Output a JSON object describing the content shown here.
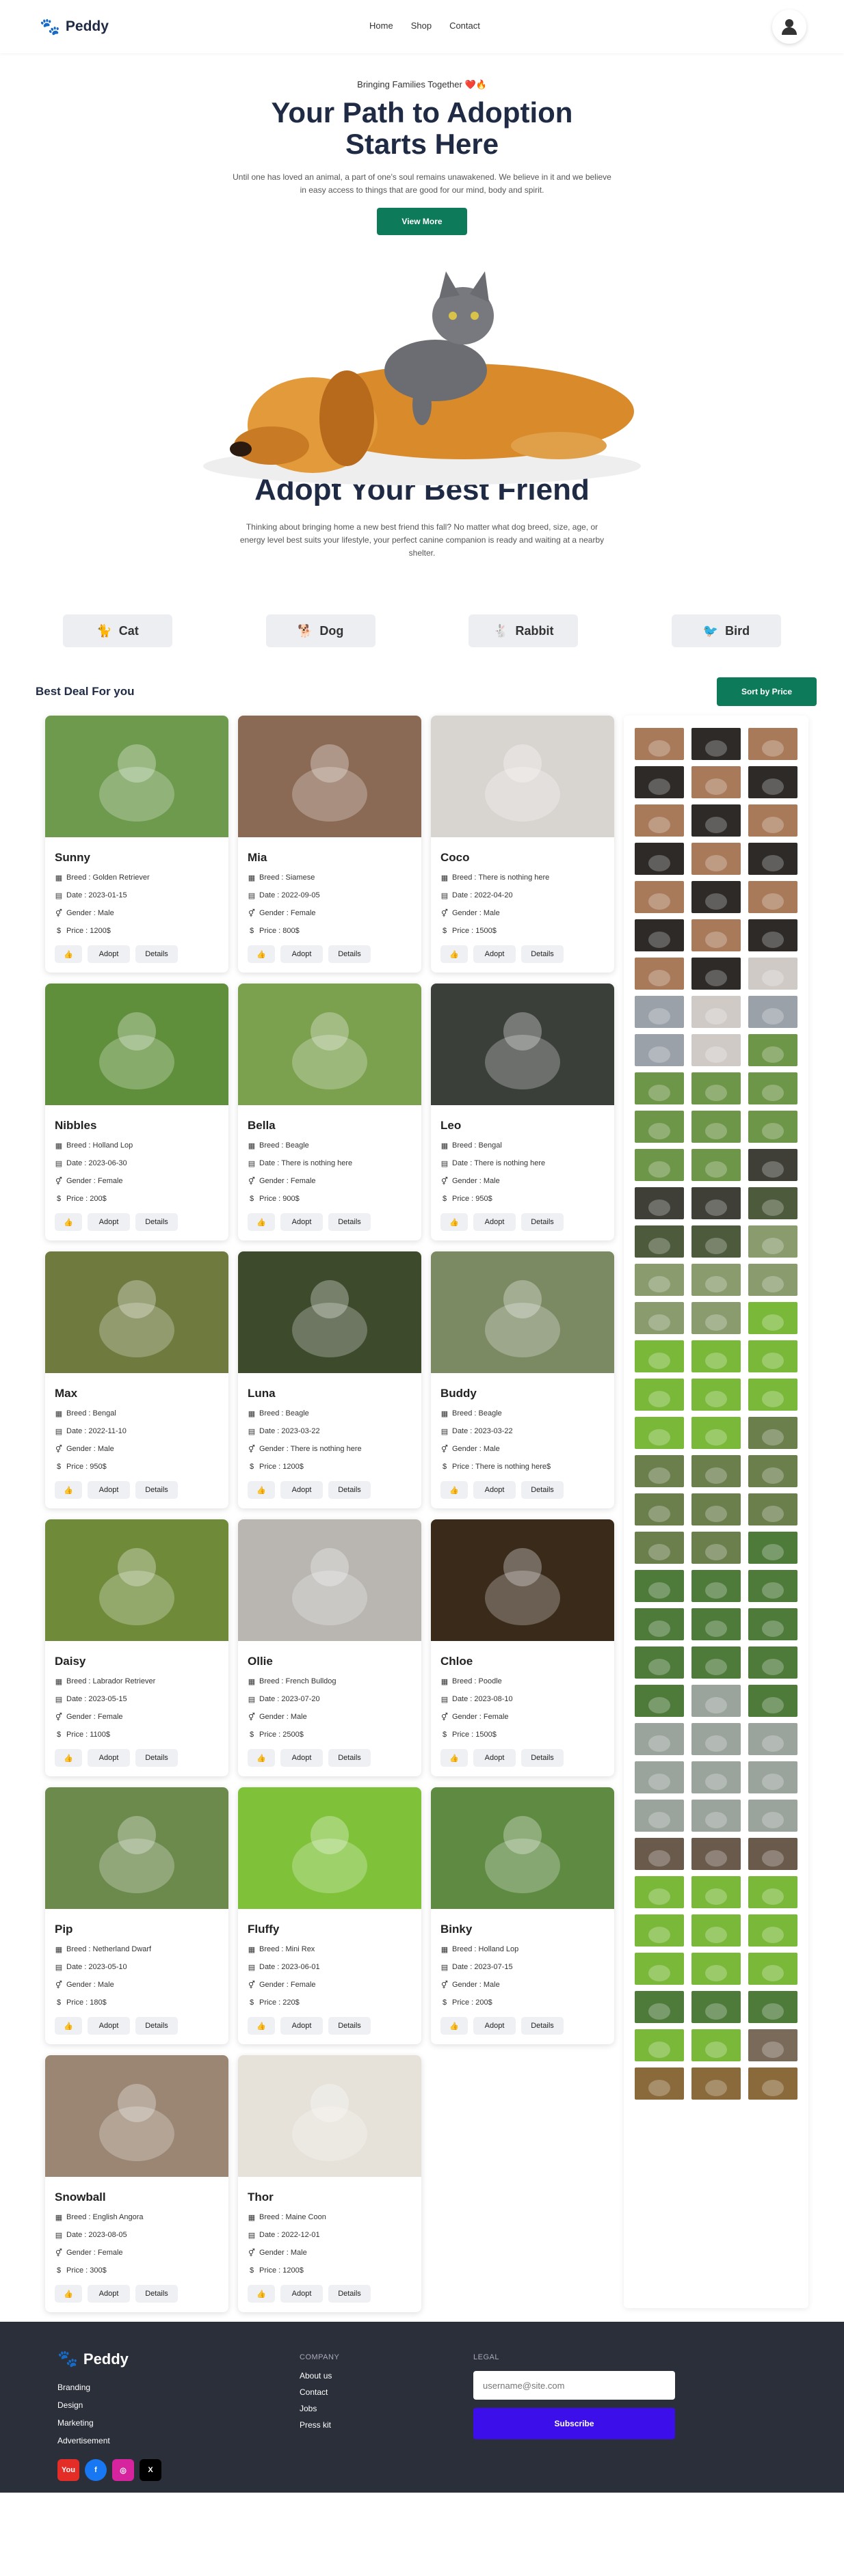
{
  "brand": {
    "name": "Peddy"
  },
  "nav": {
    "links": [
      "Home",
      "Shop",
      "Contact"
    ]
  },
  "hero": {
    "tagline": "Bringing Families Together ❤️🔥",
    "title": "Your Path to Adoption Starts Here",
    "subtitle": "Until one has loved an animal, a part of one's soul remains unawakened. We believe in it and we believe in easy access to things that are good for our mind, body and spirit.",
    "button": "View More"
  },
  "adopt": {
    "title": "Adopt Your Best Friend",
    "text": "Thinking about bringing home a new best friend this fall? No matter what dog breed, size, age, or energy level best suits your lifestyle, your perfect canine companion is ready and waiting at a nearby shelter."
  },
  "categories": [
    {
      "label": "Cat",
      "icon": "cat-icon"
    },
    {
      "label": "Dog",
      "icon": "dog-icon"
    },
    {
      "label": "Rabbit",
      "icon": "rabbit-icon"
    },
    {
      "label": "Bird",
      "icon": "bird-icon"
    }
  ],
  "deal": {
    "title": "Best Deal For you",
    "sort": "Sort by Price"
  },
  "actions": {
    "adopt": "Adopt",
    "details": "Details"
  },
  "pets": [
    {
      "name": "Sunny",
      "breed": "Breed : Golden Retriever",
      "date": "Date : 2023-01-15",
      "gender": "Gender : Male",
      "price": "Price : 1200$",
      "bg": "#6d9a4c"
    },
    {
      "name": "Mia",
      "breed": "Breed : Siamese",
      "date": "Date : 2022-09-05",
      "gender": "Gender : Female",
      "price": "Price : 800$",
      "bg": "#8b6a55"
    },
    {
      "name": "Coco",
      "breed": "Breed : There is nothing here",
      "date": "Date : 2022-04-20",
      "gender": "Gender : Male",
      "price": "Price : 1500$",
      "bg": "#d8d4d0"
    },
    {
      "name": "Nibbles",
      "breed": "Breed : Holland Lop",
      "date": "Date : 2023-06-30",
      "gender": "Gender : Female",
      "price": "Price : 200$",
      "bg": "#5f8f3a"
    },
    {
      "name": "Bella",
      "breed": "Breed : Beagle",
      "date": "Date : There is nothing here",
      "gender": "Gender : Female",
      "price": "Price : 900$",
      "bg": "#7ba04e"
    },
    {
      "name": "Leo",
      "breed": "Breed : Bengal",
      "date": "Date : There is nothing here",
      "gender": "Gender : Male",
      "price": "Price : 950$",
      "bg": "#3b3f3a"
    },
    {
      "name": "Max",
      "breed": "Breed : Bengal",
      "date": "Date : 2022-11-10",
      "gender": "Gender : Male",
      "price": "Price : 950$",
      "bg": "#6e7a3e"
    },
    {
      "name": "Luna",
      "breed": "Breed : Beagle",
      "date": "Date : 2023-03-22",
      "gender": "Gender : There is nothing here",
      "price": "Price : 1200$",
      "bg": "#3d4a2c"
    },
    {
      "name": "Buddy",
      "breed": "Breed : Beagle",
      "date": "Date : 2023-03-22",
      "gender": "Gender : Male",
      "price": "Price : There is nothing here$",
      "bg": "#7c8a64"
    },
    {
      "name": "Daisy",
      "breed": "Breed : Labrador Retriever",
      "date": "Date : 2023-05-15",
      "gender": "Gender : Female",
      "price": "Price : 1100$",
      "bg": "#6f8b3a"
    },
    {
      "name": "Ollie",
      "breed": "Breed : French Bulldog",
      "date": "Date : 2023-07-20",
      "gender": "Gender : Male",
      "price": "Price : 2500$",
      "bg": "#b9b6b2"
    },
    {
      "name": "Chloe",
      "breed": "Breed : Poodle",
      "date": "Date : 2023-08-10",
      "gender": "Gender : Female",
      "price": "Price : 1500$",
      "bg": "#3a2a1a"
    },
    {
      "name": "Pip",
      "breed": "Breed : Netherland Dwarf",
      "date": "Date : 2023-05-10",
      "gender": "Gender : Male",
      "price": "Price : 180$",
      "bg": "#6c8a4c"
    },
    {
      "name": "Fluffy",
      "breed": "Breed : Mini Rex",
      "date": "Date : 2023-06-01",
      "gender": "Gender : Female",
      "price": "Price : 220$",
      "bg": "#7fc23a"
    },
    {
      "name": "Binky",
      "breed": "Breed : Holland Lop",
      "date": "Date : 2023-07-15",
      "gender": "Gender : Male",
      "price": "Price : 200$",
      "bg": "#5e8a42"
    },
    {
      "name": "Snowball",
      "breed": "Breed : English Angora",
      "date": "Date : 2023-08-05",
      "gender": "Gender : Female",
      "price": "Price : 300$",
      "bg": "#9a8672"
    },
    {
      "name": "Thor",
      "breed": "Breed : Maine Coon",
      "date": "Date : 2022-12-01",
      "gender": "Gender : Male",
      "price": "Price : 1200$",
      "bg": "#e6e2da"
    }
  ],
  "liked_colors": [
    "#a87a5a",
    "#2d2a28",
    "#a87a5a",
    "#2d2a28",
    "#a87a5a",
    "#2d2a28",
    "#a87a5a",
    "#2d2a28",
    "#a87a5a",
    "#2d2a28",
    "#a87a5a",
    "#2d2a28",
    "#a87a5a",
    "#2d2a28",
    "#a87a5a",
    "#2d2a28",
    "#a87a5a",
    "#2d2a28",
    "#a87a5a",
    "#2d2a28",
    "#cfcac6",
    "#9aa1a8",
    "#cfcac6",
    "#9aa1a8",
    "#9aa1a8",
    "#cfcac6",
    "#6e9648",
    "#6e9648",
    "#6e9648",
    "#6e9648",
    "#6e9648",
    "#6e9648",
    "#6e9648",
    "#6e9648",
    "#6e9648",
    "#3f3f38",
    "#3f3f38",
    "#3f3f38",
    "#4d5a3b",
    "#4d5a3b",
    "#4d5a3b",
    "#8a9b6e",
    "#8a9b6e",
    "#8a9b6e",
    "#8a9b6e",
    "#8a9b6e",
    "#8a9b6e",
    "#7ab83a",
    "#7ab83a",
    "#7ab83a",
    "#7ab83a",
    "#7ab83a",
    "#7ab83a",
    "#7ab83a",
    "#7ab83a",
    "#7ab83a",
    "#6b7f4c",
    "#6b7f4c",
    "#6b7f4c",
    "#6b7f4c",
    "#6b7f4c",
    "#6b7f4c",
    "#6b7f4c",
    "#6b7f4c",
    "#6b7f4c",
    "#4e7a3a",
    "#4e7a3a",
    "#4e7a3a",
    "#4e7a3a",
    "#4e7a3a",
    "#4e7a3a",
    "#4e7a3a",
    "#4e7a3a",
    "#4e7a3a",
    "#4e7a3a",
    "#4e7a3a",
    "#9aa39c",
    "#4e7a3a",
    "#9aa39c",
    "#9aa39c",
    "#9aa39c",
    "#9aa39c",
    "#9aa39c",
    "#9aa39c",
    "#9aa39c",
    "#9aa39c",
    "#9aa39c",
    "#6a5a4c",
    "#6a5a4c",
    "#6a5a4c",
    "#7ab83a",
    "#7ab83a",
    "#7ab83a",
    "#7ab83a",
    "#7ab83a",
    "#7ab83a",
    "#7ab83a",
    "#7ab83a",
    "#7ab83a",
    "#4e7a3a",
    "#4e7a3a",
    "#4e7a3a",
    "#7ab83a",
    "#7ab83a",
    "#7a6a5a",
    "#8a6a3a",
    "#8a6a3a",
    "#8a6a3a"
  ],
  "footer": {
    "brand": "Peddy",
    "links1": [
      "Branding",
      "Design",
      "Marketing",
      "Advertisement"
    ],
    "company_title": "COMPANY",
    "company": [
      "About us",
      "Contact",
      "Jobs",
      "Press kit"
    ],
    "legal_title": "LEGAL",
    "email_placeholder": "username@site.com",
    "subscribe": "Subscribe",
    "social": [
      {
        "name": "youtube-icon",
        "label": "You",
        "color": "#e52d27"
      },
      {
        "name": "facebook-icon",
        "label": "f",
        "color": "#1877f2"
      },
      {
        "name": "instagram-icon",
        "label": "◎",
        "color": "#d6249f"
      },
      {
        "name": "x-icon",
        "label": "X",
        "color": "#000000"
      }
    ]
  }
}
